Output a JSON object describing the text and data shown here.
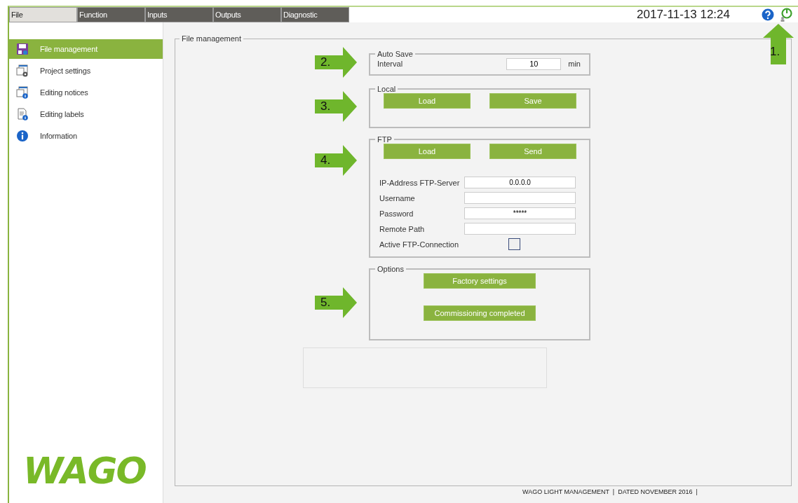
{
  "menu": {
    "tabs": [
      {
        "label": "File",
        "selected": true
      },
      {
        "label": "Function",
        "selected": false
      },
      {
        "label": "Inputs",
        "selected": false
      },
      {
        "label": "Outputs",
        "selected": false
      },
      {
        "label": "Diagnostic",
        "selected": false
      }
    ]
  },
  "datetime": "2017-11-13 12:24",
  "header_callout": "1.",
  "sidebar": {
    "items": [
      {
        "label": "File management",
        "selected": true
      },
      {
        "label": "Project settings",
        "selected": false
      },
      {
        "label": "Editing notices",
        "selected": false
      },
      {
        "label": "Editing labels",
        "selected": false
      },
      {
        "label": "Information",
        "selected": false
      }
    ]
  },
  "logo": "WAGO",
  "panel": {
    "title": "File management",
    "groups": [
      {
        "kind": "interval",
        "title": "Auto Save",
        "callout": "2.",
        "label": "Interval",
        "value": "10",
        "unit": "min"
      },
      {
        "kind": "buttons",
        "title": "Local",
        "callout": "3.",
        "buttons": [
          "Load",
          "Save"
        ]
      },
      {
        "kind": "ftp",
        "title": "FTP",
        "callout": "4.",
        "buttons": [
          "Load",
          "Send"
        ],
        "fields": [
          {
            "label": "IP-Address FTP-Server",
            "value": "0.0.0.0"
          },
          {
            "label": "Username"
          },
          {
            "label": "Password",
            "value": "*****"
          },
          {
            "label": "Remote Path"
          }
        ],
        "checkbox": {
          "label": "Active FTP-Connection",
          "checked": false
        }
      },
      {
        "kind": "options",
        "title": "Options",
        "callout": "5.",
        "buttons": [
          "Factory settings",
          "Commissioning completed"
        ]
      }
    ]
  },
  "footer": "WAGO LIGHT MANAGEMENT  |  DATED NOVEMBER 2016  |"
}
